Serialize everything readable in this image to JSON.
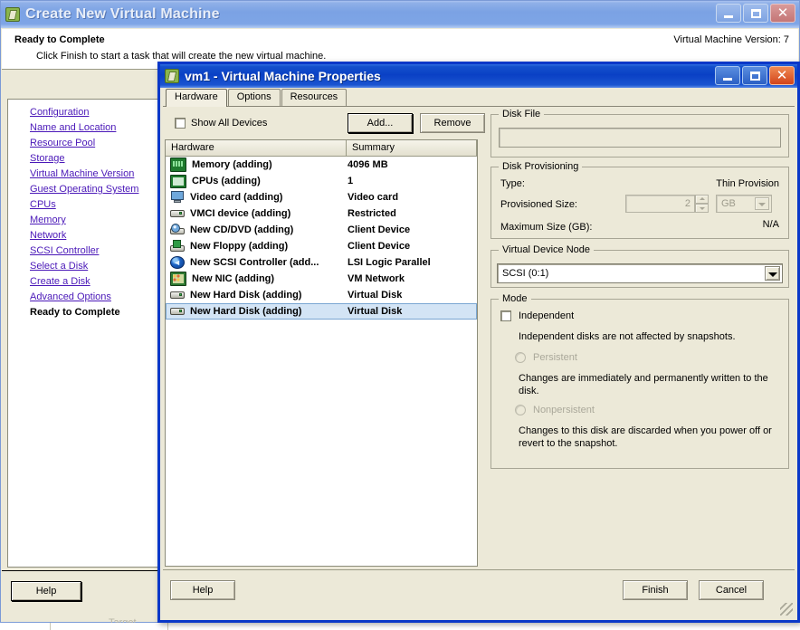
{
  "outer_window": {
    "title": "Create New Virtual Machine",
    "icon": "vm-app-icon",
    "controls": {
      "minimize": "_",
      "maximize": "□",
      "close": "✕"
    },
    "header": {
      "title": "Ready to Complete",
      "subtitle": "Click Finish to start a task that will create the new virtual machine.",
      "version_label": "Virtual Machine Version: 7"
    },
    "nav": {
      "items": [
        {
          "label": "Configuration",
          "current": false
        },
        {
          "label": "Name and Location",
          "current": false
        },
        {
          "label": "Resource Pool",
          "current": false
        },
        {
          "label": "Storage",
          "current": false
        },
        {
          "label": "Virtual Machine Version",
          "current": false
        },
        {
          "label": "Guest Operating System",
          "current": false
        },
        {
          "label": "CPUs",
          "current": false
        },
        {
          "label": "Memory",
          "current": false
        },
        {
          "label": "Network",
          "current": false
        },
        {
          "label": "SCSI Controller",
          "current": false
        },
        {
          "label": "Select a Disk",
          "current": false
        },
        {
          "label": "Create a Disk",
          "current": false
        },
        {
          "label": "Advanced Options",
          "current": false
        },
        {
          "label": "Ready to Complete",
          "current": true
        }
      ]
    },
    "footer": {
      "help_label": "Help"
    },
    "background_text": "Target"
  },
  "inner_dialog": {
    "title": "vm1 - Virtual Machine Properties",
    "icon": "vm-app-icon",
    "controls": {
      "minimize": "_",
      "maximize": "□",
      "close": "✕"
    },
    "tabs": [
      {
        "label": "Hardware",
        "selected": true
      },
      {
        "label": "Options",
        "selected": false
      },
      {
        "label": "Resources",
        "selected": false
      }
    ],
    "toolbar": {
      "show_all_devices_label": "Show All Devices",
      "show_all_devices_checked": false,
      "add_label": "Add...",
      "remove_label": "Remove"
    },
    "hardware_table": {
      "columns": [
        "Hardware",
        "Summary"
      ],
      "rows": [
        {
          "icon": "memory-icon",
          "name": "Memory (adding)",
          "summary": "4096 MB",
          "selected": false
        },
        {
          "icon": "cpu-icon",
          "name": "CPUs (adding)",
          "summary": "1",
          "selected": false
        },
        {
          "icon": "video-card-icon",
          "name": "Video card  (adding)",
          "summary": "Video card",
          "selected": false
        },
        {
          "icon": "vmci-device-icon",
          "name": "VMCI device (adding)",
          "summary": "Restricted",
          "selected": false
        },
        {
          "icon": "cd-dvd-icon",
          "name": "New CD/DVD (adding)",
          "summary": "Client Device",
          "selected": false
        },
        {
          "icon": "floppy-icon",
          "name": "New Floppy (adding)",
          "summary": "Client Device",
          "selected": false
        },
        {
          "icon": "scsi-controller-icon",
          "name": "New SCSI Controller (add...",
          "summary": "LSI Logic Parallel",
          "selected": false
        },
        {
          "icon": "nic-icon",
          "name": "New NIC (adding)",
          "summary": "VM Network",
          "selected": false
        },
        {
          "icon": "hard-disk-icon",
          "name": "New Hard Disk (adding)",
          "summary": "Virtual Disk",
          "selected": false
        },
        {
          "icon": "hard-disk-icon",
          "name": "New Hard Disk (adding)",
          "summary": "Virtual Disk",
          "selected": true
        }
      ]
    },
    "disk_file": {
      "legend": "Disk File",
      "value": ""
    },
    "disk_provisioning": {
      "legend": "Disk Provisioning",
      "type_label": "Type:",
      "type_value": "Thin Provision",
      "provisioned_size_label": "Provisioned Size:",
      "provisioned_size_value": "2",
      "provisioned_size_unit": "GB",
      "maximum_size_label": "Maximum Size (GB):",
      "maximum_size_value": "N/A"
    },
    "virtual_device_node": {
      "legend": "Virtual Device Node",
      "selected": "SCSI (0:1)"
    },
    "mode": {
      "legend": "Mode",
      "independent_label": "Independent",
      "independent_checked": false,
      "independent_desc": "Independent disks are not affected by snapshots.",
      "persistent_label": "Persistent",
      "persistent_desc": "Changes are immediately and permanently written to the disk.",
      "nonpersistent_label": "Nonpersistent",
      "nonpersistent_desc": "Changes to this disk are discarded when you power off or revert to the snapshot."
    },
    "footer": {
      "help_label": "Help",
      "finish_label": "Finish",
      "cancel_label": "Cancel"
    }
  }
}
